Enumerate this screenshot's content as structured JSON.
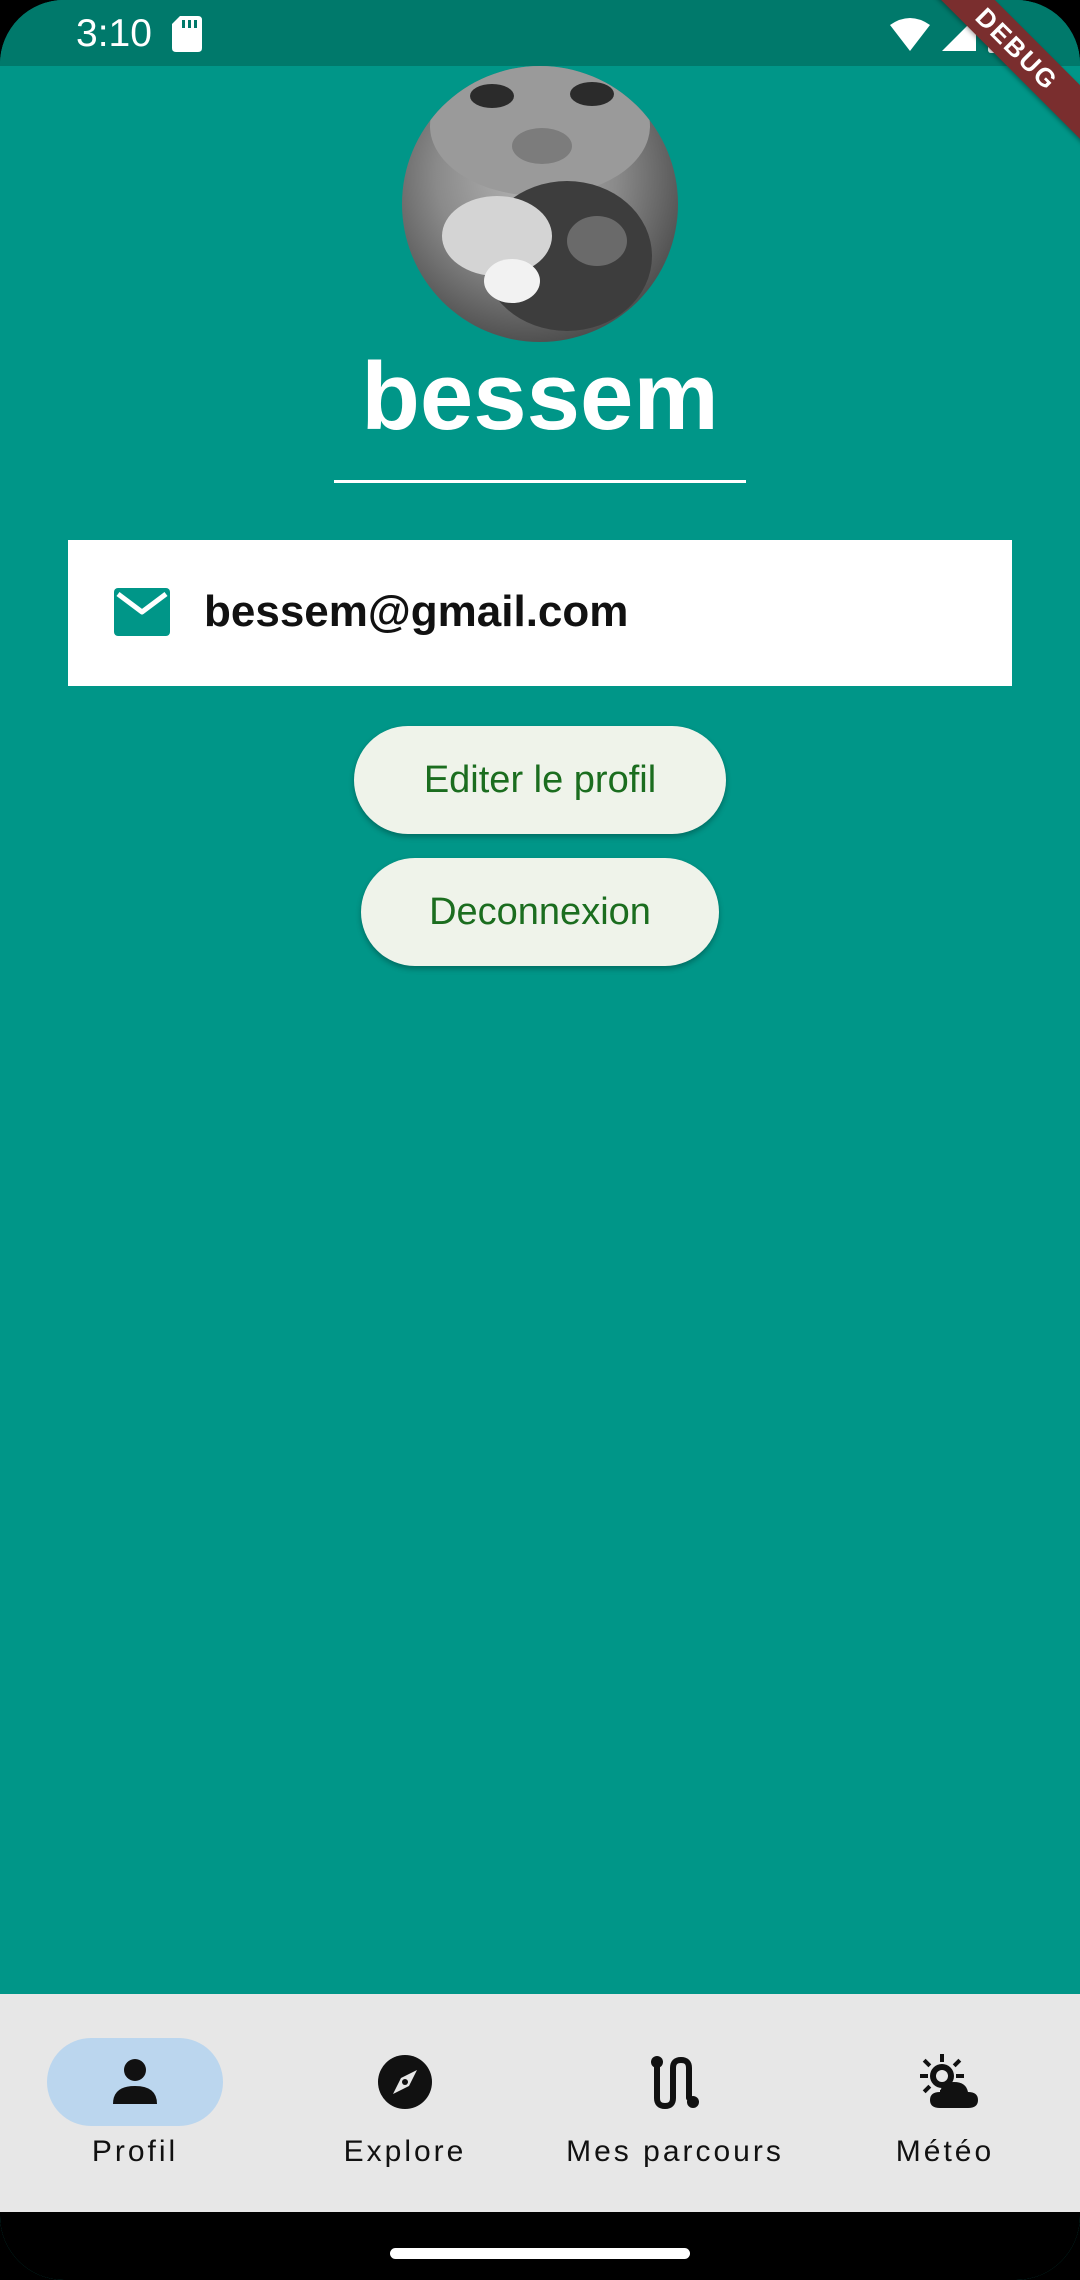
{
  "status_bar": {
    "time": "3:10",
    "icons": [
      "sd-card-icon",
      "wifi-icon",
      "signal-icon",
      "battery-icon"
    ]
  },
  "debug_banner": "DEBUG",
  "profile": {
    "name": "bessem",
    "email": "bessem@gmail.com",
    "email_icon": "mail-icon"
  },
  "actions": {
    "edit_label": "Editer le profil",
    "logout_label": "Deconnexion"
  },
  "bottom_nav": {
    "active_index": 0,
    "items": [
      {
        "label": "Profil",
        "icon": "person-icon"
      },
      {
        "label": "Explore",
        "icon": "compass-icon"
      },
      {
        "label": "Mes parcours",
        "icon": "route-icon"
      },
      {
        "label": "Météo",
        "icon": "weather-icon"
      }
    ]
  },
  "colors": {
    "background": "#009688",
    "status_bar": "#00796B",
    "button_bg": "#EFF3EA",
    "button_text": "#1B6D1F",
    "nav_bg": "#E7E7E7",
    "nav_active": "#BBD6EE"
  }
}
